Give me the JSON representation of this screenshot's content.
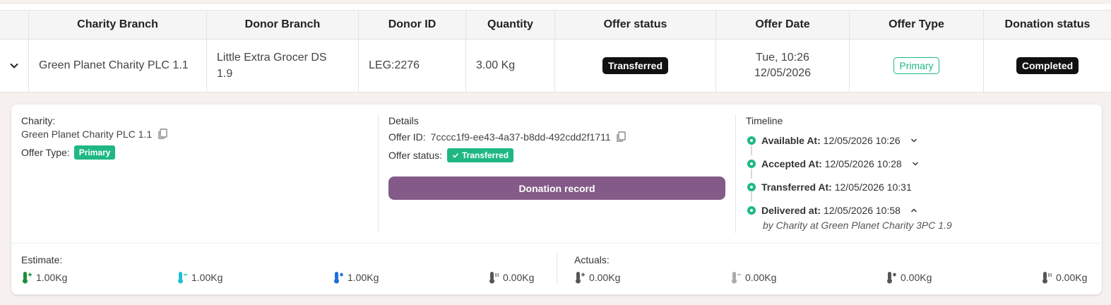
{
  "table": {
    "headers": [
      "Charity Branch",
      "Donor Branch",
      "Donor ID",
      "Quantity",
      "Offer status",
      "Offer Date",
      "Offer Type",
      "Donation status"
    ],
    "row": {
      "charity_branch": "Green Planet Charity PLC 1.1",
      "donor_branch_line1": "Little Extra Grocer DS",
      "donor_branch_line2": "1.9",
      "donor_id": "LEG:2276",
      "quantity": "3.00 Kg",
      "offer_status": "Transferred",
      "offer_date_line1": "Tue, 10:26",
      "offer_date_line2": "12/05/2026",
      "offer_type": "Primary",
      "donation_status": "Completed"
    }
  },
  "detail": {
    "charity": {
      "label": "Charity:",
      "name": "Green Planet Charity PLC 1.1",
      "offer_type_label": "Offer Type:",
      "offer_type": "Primary"
    },
    "details": {
      "title": "Details",
      "offer_id_label": "Offer ID:",
      "offer_id": "7cccc1f9-ee43-4a37-b8dd-492cdd2f1711",
      "offer_status_label": "Offer status:",
      "offer_status": "Transferred",
      "donation_button": "Donation record"
    },
    "timeline": {
      "title": "Timeline",
      "items": [
        {
          "label": "Available At:",
          "value": "12/05/2026 10:26"
        },
        {
          "label": "Accepted At:",
          "value": "12/05/2026 10:28"
        },
        {
          "label": "Transferred At:",
          "value": "12/05/2026 10:31"
        },
        {
          "label": "Delivered at:",
          "value": "12/05/2026 10:58"
        }
      ],
      "delivered_by": "by Charity at Green Planet Charity 3PC 1.9"
    },
    "estimate": {
      "label": "Estimate:",
      "values": [
        "1.00Kg",
        "1.00Kg",
        "1.00Kg",
        "0.00Kg"
      ]
    },
    "actuals": {
      "label": "Actuals:",
      "values": [
        "0.00Kg",
        "0.00Kg",
        "0.00Kg",
        "0.00Kg"
      ]
    }
  },
  "colors": {
    "accent_green": "#1fb883",
    "button_purple": "#845a88",
    "ambient_green": "#1e8c3a",
    "chilled_cyan": "#1fbfd6",
    "frozen_blue": "#1e6fd9",
    "grey_icon": "#666666"
  },
  "icons": [
    "chevron-down-icon",
    "copy-icon",
    "check-icon",
    "thermometer-ambient-icon",
    "thermometer-chilled-icon",
    "thermometer-frozen-icon",
    "thermometer-other-icon"
  ]
}
